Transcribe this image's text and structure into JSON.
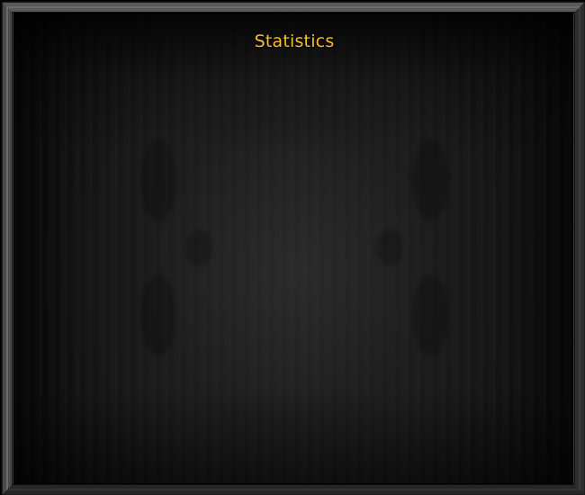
{
  "window": {
    "title": "Statistics"
  },
  "colors": {
    "title_text": "#f4c12a",
    "frame": "#3a3a3a",
    "panel_background": "#1a1a1a"
  }
}
